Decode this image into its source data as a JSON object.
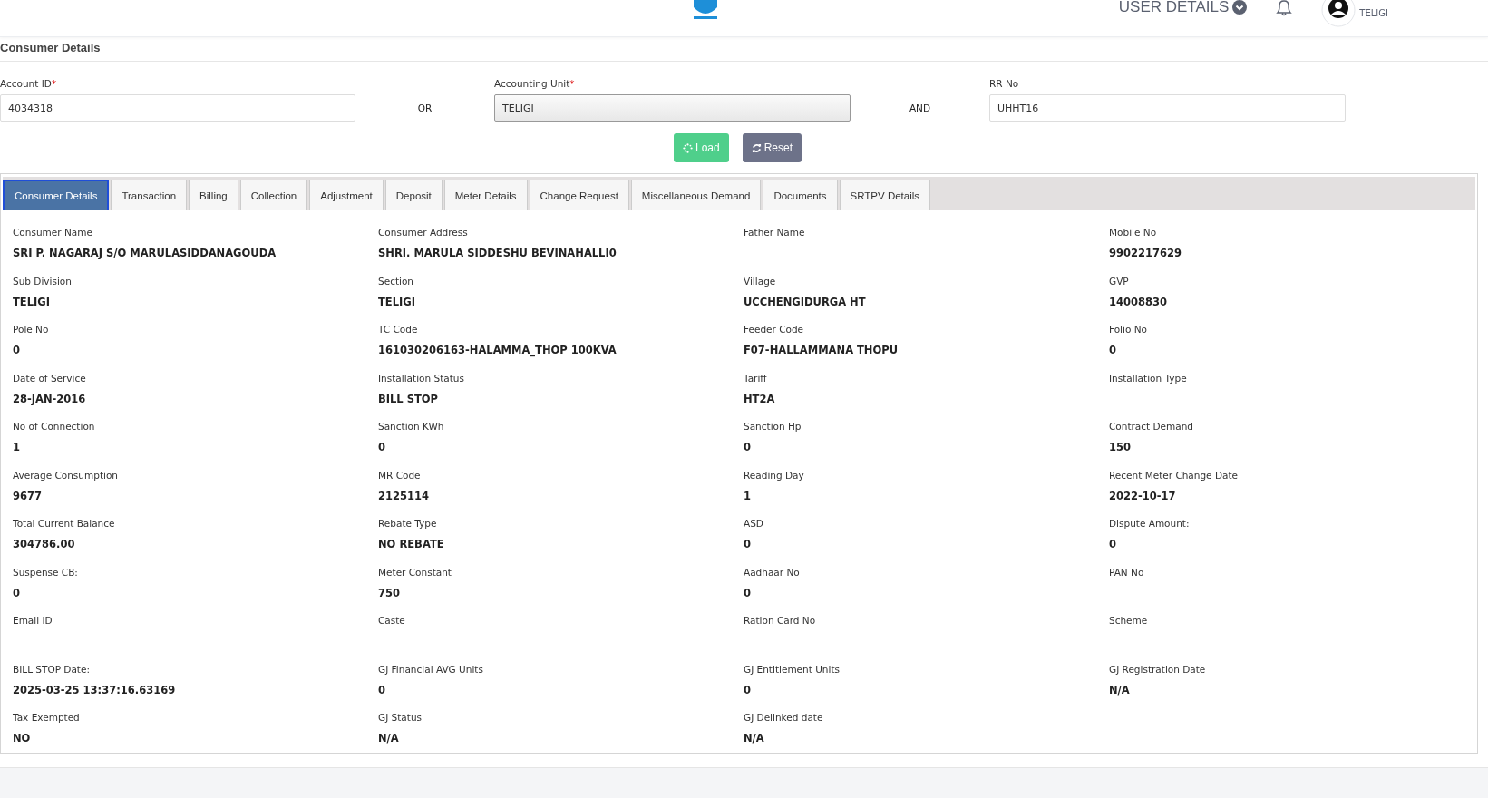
{
  "header": {
    "user_menu": "USER DETAILS",
    "user_unit": "TELIGI"
  },
  "page_title": "Consumer Details",
  "search": [
    {
      "kind": "field",
      "label": "Account ID",
      "required_mark": "*",
      "value": "4034318",
      "shaded": false
    },
    {
      "kind": "joiner",
      "text": "OR"
    },
    {
      "kind": "field",
      "label": "Accounting Unit",
      "required_mark": "*",
      "value": "TELIGI",
      "shaded": true
    },
    {
      "kind": "joiner",
      "text": "AND"
    },
    {
      "kind": "field",
      "label": "RR No",
      "value": "UHHT16",
      "shaded": false
    }
  ],
  "buttons": [
    {
      "label": "Load",
      "kind": "load"
    },
    {
      "label": "Reset",
      "kind": "reset"
    }
  ],
  "tabs": [
    {
      "label": "Consumer Details",
      "selected": true
    },
    {
      "label": "Transaction",
      "selected": false
    },
    {
      "label": "Billing",
      "selected": false
    },
    {
      "label": "Collection",
      "selected": false
    },
    {
      "label": "Adjustment",
      "selected": false
    },
    {
      "label": "Deposit",
      "selected": false
    },
    {
      "label": "Meter Details",
      "selected": false
    },
    {
      "label": "Change Request",
      "selected": false
    },
    {
      "label": "Miscellaneous Demand",
      "selected": false
    },
    {
      "label": "Documents",
      "selected": false
    },
    {
      "label": "SRTPV Details",
      "selected": false
    }
  ],
  "details": [
    {
      "label": "Consumer Name",
      "value": "SRI P. NAGARAJ S/O MARULASIDDANAGOUDA"
    },
    {
      "label": "Consumer Address",
      "value": "SHRI. MARULA SIDDESHU BEVINAHALLI0"
    },
    {
      "label": "Father Name"
    },
    {
      "label": "Mobile No",
      "value": "9902217629"
    },
    {
      "label": "Sub Division",
      "value": "TELIGI"
    },
    {
      "label": "Section",
      "value": "TELIGI"
    },
    {
      "label": "Village",
      "value": "UCCHENGIDURGA HT"
    },
    {
      "label": "GVP",
      "value": "14008830"
    },
    {
      "label": "Pole No",
      "value": "0"
    },
    {
      "label": "TC Code",
      "value": "161030206163-HALAMMA_THOP 100KVA"
    },
    {
      "label": "Feeder Code",
      "value": "F07-HALLAMMANA THOPU"
    },
    {
      "label": "Folio No",
      "value": "0"
    },
    {
      "label": "Date of Service",
      "value": "28-JAN-2016"
    },
    {
      "label": "Installation Status",
      "value": "BILL STOP"
    },
    {
      "label": "Tariff",
      "value": "HT2A"
    },
    {
      "label": "Installation Type"
    },
    {
      "label": "No of Connection",
      "value": "1"
    },
    {
      "label": "Sanction KWh",
      "value": "0"
    },
    {
      "label": "Sanction Hp",
      "value": "0"
    },
    {
      "label": "Contract Demand",
      "value": "150"
    },
    {
      "label": "Average Consumption",
      "value": "9677"
    },
    {
      "label": "MR Code",
      "value": "2125114"
    },
    {
      "label": "Reading Day",
      "value": "1"
    },
    {
      "label": "Recent Meter Change Date",
      "value": "2022-10-17"
    },
    {
      "label": "Total Current Balance",
      "value": "304786.00"
    },
    {
      "label": "Rebate Type",
      "value": "NO REBATE"
    },
    {
      "label": "ASD",
      "value": "0"
    },
    {
      "label": "Dispute Amount:",
      "value": "0"
    },
    {
      "label": "Suspense CB:",
      "value": "0"
    },
    {
      "label": "Meter Constant",
      "value": "750"
    },
    {
      "label": "Aadhaar No",
      "value": "0"
    },
    {
      "label": "PAN No"
    },
    {
      "label": "Email ID"
    },
    {
      "label": "Caste"
    },
    {
      "label": "Ration Card No"
    },
    {
      "label": "Scheme"
    },
    {
      "label": "BILL STOP Date:",
      "value": "2025-03-25 13:37:16.63169"
    },
    {
      "label": "GJ Financial AVG Units",
      "value": "0"
    },
    {
      "label": "GJ Entitlement Units",
      "value": "0"
    },
    {
      "label": "GJ Registration Date",
      "value": "N/A"
    },
    {
      "label": "Tax Exempted",
      "value": "NO"
    },
    {
      "label": "GJ Status",
      "value": "N/A"
    },
    {
      "label": "GJ Delinked date",
      "value": "N/A"
    }
  ]
}
